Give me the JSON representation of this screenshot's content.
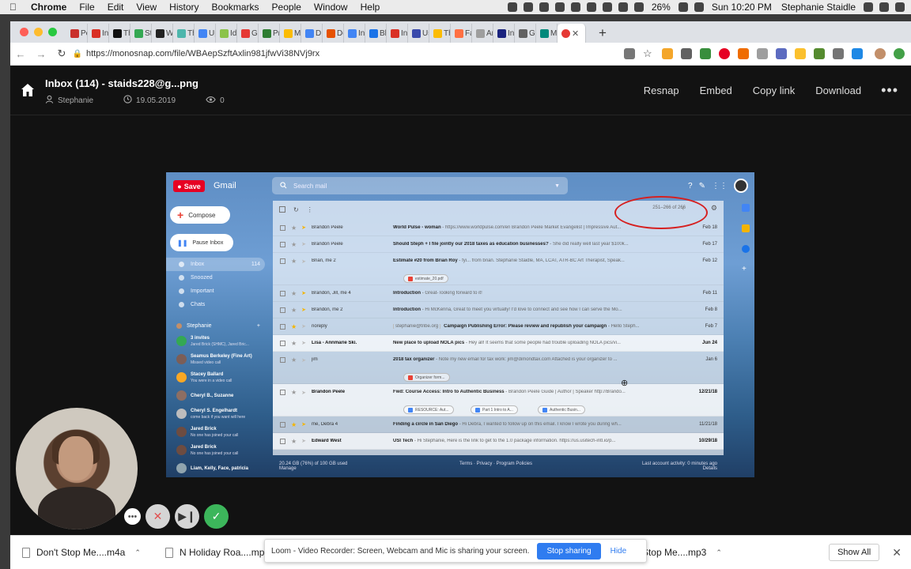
{
  "menubar": {
    "app": "Chrome",
    "items": [
      "File",
      "Edit",
      "View",
      "History",
      "Bookmarks",
      "People",
      "Window",
      "Help"
    ],
    "battery": "26%",
    "clock": "Sun 10:20 PM",
    "user": "Stephanie Staidle"
  },
  "tabs": [
    {
      "label": "Pe",
      "color": "#c9302c"
    },
    {
      "label": "Int",
      "color": "#d93025"
    },
    {
      "label": "Th",
      "color": "#111111"
    },
    {
      "label": "St",
      "color": "#34a853"
    },
    {
      "label": "Wc",
      "color": "#222222"
    },
    {
      "label": "Th",
      "color": "#4db6ac"
    },
    {
      "label": "Up",
      "color": "#4285f4"
    },
    {
      "label": "Ide",
      "color": "#8bc34a"
    },
    {
      "label": "Gu",
      "color": "#e53935"
    },
    {
      "label": "Pri",
      "color": "#2e7d32"
    },
    {
      "label": "My",
      "color": "#fbbc04"
    },
    {
      "label": "DF",
      "color": "#4285f4"
    },
    {
      "label": "Do",
      "color": "#e65100"
    },
    {
      "label": "Ins",
      "color": "#4285f4"
    },
    {
      "label": "Bk",
      "color": "#1a73e8"
    },
    {
      "label": "Int",
      "color": "#d93025"
    },
    {
      "label": "Us",
      "color": "#3949ab"
    },
    {
      "label": "Th",
      "color": "#fbbc04"
    },
    {
      "label": "Fa",
      "color": "#ff7043"
    },
    {
      "label": "Ar",
      "color": "#9e9e9e"
    },
    {
      "label": "Int",
      "color": "#1a237e"
    },
    {
      "label": "Gu",
      "color": "#616161"
    },
    {
      "label": "Mc",
      "color": "#00897b"
    }
  ],
  "active_tab_color": "#e53935",
  "address": {
    "url": "https://monosnap.com/file/WBAepSzftAxlin981jfwVi38NVj9rx"
  },
  "monosnap": {
    "title": "Inbox (114) - staids228@g...png",
    "author": "Stephanie",
    "date": "19.05.2019",
    "views": "0",
    "actions": [
      "Resnap",
      "Embed",
      "Copy link",
      "Download"
    ]
  },
  "gmail": {
    "save": "Save",
    "logo": "Gmail",
    "search_placeholder": "Search mail",
    "compose": "Compose",
    "pause_inbox": "Pause Inbox",
    "nav": [
      {
        "label": "Inbox",
        "count": "114",
        "selected": true
      },
      {
        "label": "Snoozed",
        "count": ""
      },
      {
        "label": "Important",
        "count": ""
      },
      {
        "label": "Chats",
        "count": ""
      }
    ],
    "hangouts_user": "Stephanie",
    "hangouts": [
      {
        "name": "3 invites",
        "sub": "Jared Brick (SHMC), Jared Bric...",
        "color": "#34a853"
      },
      {
        "name": "Seamus Berkeley (Fine Art)",
        "sub": "Missed video call",
        "color": "#7b5e57"
      },
      {
        "name": "Stacey Ballard",
        "sub": "You were in a video call",
        "color": "#f9a825"
      },
      {
        "name": "Cheryl B., Suzanne",
        "sub": "",
        "color": "#8d6e63"
      },
      {
        "name": "Cheryl S. Engelhardt",
        "sub": "come back if you want will here",
        "color": "#bdbdbd"
      },
      {
        "name": "Jared Brick",
        "sub": "No one has joined your call",
        "color": "#6d4c41"
      },
      {
        "name": "Jared Brick",
        "sub": "No one has joined your call",
        "color": "#6d4c41"
      },
      {
        "name": "Liam, Kelly, Face, patricia",
        "sub": "",
        "color": "#90a4ae"
      }
    ],
    "pager": "251–266 of 266",
    "rows": [
      {
        "sender": "Brandon Peele",
        "subject": "World Pulse - woman",
        "snippet": " - https://www.worldpulse.com/en Brandon Peele Market Evangelist | Impressive Aut...",
        "date": "Feb 18",
        "star": false,
        "imp": true,
        "unread": false
      },
      {
        "sender": "Brandon Peele",
        "subject": "Should Steph + I file jointly our 2018 taxes as education businesses?",
        "snippet": " - She did really well last year $100k...",
        "date": "Feb 17",
        "star": false,
        "imp": false,
        "unread": false
      },
      {
        "sender": "Brian, me 2",
        "subject": "Estimate #20 from Brian Roy",
        "snippet": " - fyi... from brian. Stephanie Staidle, MA, LCAT, ATR-BC Art Therapist, Speak...",
        "date": "Feb 12",
        "star": false,
        "imp": false,
        "unread": false,
        "attach": [
          "estimate_20.pdf"
        ]
      },
      {
        "sender": "Brandon, Jill, me 4",
        "subject": "Introduction",
        "snippet": " - Great- looking forward to it!",
        "date": "Feb 11",
        "star": false,
        "imp": true,
        "unread": false
      },
      {
        "sender": "Brandon, me 2",
        "subject": "Introduction",
        "snippet": " - Hi McKenna, Great to meet you virtually! I'd love to connect and see how I can serve the Mo...",
        "date": "Feb 8",
        "star": false,
        "imp": true,
        "unread": false
      },
      {
        "sender": "noreply",
        "subject": "Campaign Publishing Error: Please review and republish your campaign",
        "snippet": " - Hello Steph...",
        "date": "Feb 7",
        "star": true,
        "imp": false,
        "unread": false,
        "label": "stephanie@tribe.org"
      },
      {
        "sender": "Lisa - Annmarie Ski.",
        "subject": "New place to upload NOLA pics",
        "snippet": " - Hey all! It seems that some people had trouble uploading NOLA pics/vi...",
        "date": "Jun 24",
        "star": false,
        "imp": false,
        "unread": true
      },
      {
        "sender": "jim",
        "subject": "2018 tax organizer",
        "snippet": " - Note my new email for tax work: jim@dimondtax.com Attached is your organizer to ...",
        "date": "Jan 6",
        "star": false,
        "imp": false,
        "unread": false,
        "attach": [
          "Organizer form..."
        ]
      },
      {
        "sender": "Brandon Peele",
        "subject": "Fwd: Course Access: Intro to Authentic Business",
        "snippet": " - Brandon Peele Guide | Author | Speaker http://Brando...",
        "date": "12/21/18",
        "star": false,
        "imp": false,
        "unread": true,
        "attach": [
          "RESOURCE: Aut...",
          "Part 1 Intro to A...",
          "Authentic Busin..."
        ]
      },
      {
        "sender": "me, Debra 4",
        "subject": "Finding a circle in San Diego",
        "snippet": " - Hi Debra, I wanted to follow up on this email. I know I wrote you during wh...",
        "date": "11/21/18",
        "star": true,
        "imp": true,
        "unread": false
      },
      {
        "sender": "Edward West",
        "subject": "USI Tech",
        "snippet": " - Hi Stephanie, Here is the link to get to the 1.0 package information. https://us.usitech-intl.io/p...",
        "date": "10/29/18",
        "star": false,
        "imp": false,
        "unread": true
      }
    ],
    "storage": "20.24 GB (76%) of 100 GB used",
    "manage": "Manage",
    "footer_links": "Terms · Privacy · Program Policies",
    "last_activity": "Last account activity: 0 minutes ago",
    "details": "Details"
  },
  "downloads": [
    {
      "name": "Don't Stop Me....m4a"
    },
    {
      "name": "N Holiday Roa....mp3"
    },
    {
      "name": "Don't Stop Me....mp3"
    }
  ],
  "show_all": "Show All",
  "loom": {
    "message": "Loom - Video Recorder: Screen, Webcam and Mic is sharing your screen.",
    "stop": "Stop sharing",
    "hide": "Hide"
  }
}
